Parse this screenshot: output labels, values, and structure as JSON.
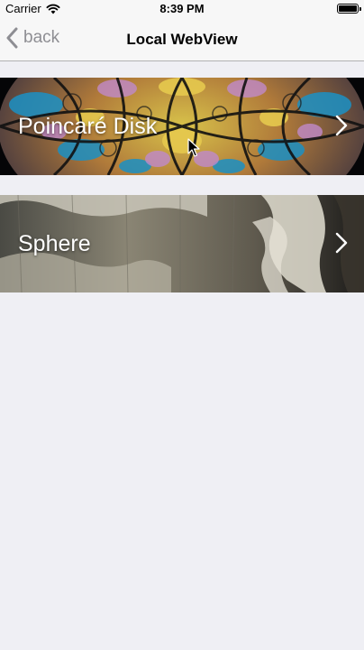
{
  "status_bar": {
    "carrier": "Carrier",
    "time": "8:39 PM",
    "battery_level": 1.0
  },
  "nav": {
    "back_label": "back",
    "title": "Local WebView"
  },
  "list": {
    "items": [
      {
        "label": "Poincaré Disk",
        "image": "stained-glass-poincare-disk"
      },
      {
        "label": "Sphere",
        "image": "cracked-globe-sphere"
      }
    ]
  },
  "icons": {
    "back": "chevron-left-icon",
    "disclosure": "chevron-right-icon",
    "wifi": "wifi-icon",
    "battery": "battery-icon",
    "cursor": "mouse-pointer-icon"
  },
  "colors": {
    "background": "#efeff4",
    "bar": "#f7f7f7",
    "back_tint": "#8e8e93",
    "label": "#ffffff"
  }
}
